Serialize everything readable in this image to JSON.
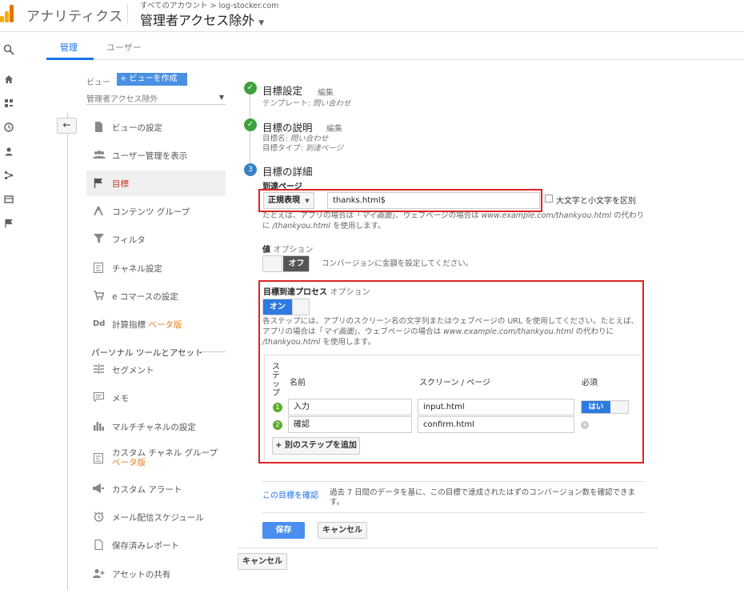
{
  "app": {
    "title": "アナリティクス",
    "breadcrumb": "すべてのアカウント > log-stocker.com",
    "view_name": "管理者アクセス除外"
  },
  "rail_icons": [
    "search-icon",
    "home-icon",
    "dashboard-icon",
    "clock-icon",
    "person-icon",
    "acquisition-icon",
    "behavior-icon",
    "flag-icon"
  ],
  "tabs": [
    {
      "label": "管理",
      "active": true
    },
    {
      "label": "ユーザー",
      "active": false
    }
  ],
  "view_panel": {
    "label": "ビュー",
    "create_button": "+ ビューを作成",
    "selected_view": "管理者アクセス除外",
    "back_icon": "←",
    "items": [
      {
        "label": "ビューの設定"
      },
      {
        "label": "ユーザー管理を表示"
      },
      {
        "label": "目標"
      },
      {
        "label": "コンテンツ グループ"
      },
      {
        "label": "フィルタ"
      },
      {
        "label": "チャネル設定"
      },
      {
        "label": "e コマースの設定"
      },
      {
        "label": "計算指標",
        "badge": "ベータ版"
      }
    ],
    "personal_header": "パーソナル ツールとアセット",
    "personal_items": [
      {
        "label": "セグメント"
      },
      {
        "label": "メモ"
      },
      {
        "label": "マルチチャネルの設定"
      },
      {
        "label": "カスタム チャネル グループ",
        "badge": "ベータ版"
      },
      {
        "label": "カスタム アラート"
      },
      {
        "label": "メール配信スケジュール"
      },
      {
        "label": "保存済みレポート"
      },
      {
        "label": "アセットの共有"
      }
    ]
  },
  "goal": {
    "setup": {
      "title": "目標設定",
      "edit": "編集",
      "template_label": "テンプレート:",
      "template_value": "問い合わせ"
    },
    "description": {
      "title": "目標の説明",
      "edit": "編集",
      "name_label": "目標名:",
      "name_value": "問い合わせ",
      "type_label": "目標タイプ:",
      "type_value": "到達ページ"
    },
    "details": {
      "step_number": "3",
      "title": "目標の詳細",
      "destination_label": "到達ページ",
      "match_type": "正規表現",
      "destination_value": "thanks.html$",
      "case_sensitive_label": "大文字と小文字を区別",
      "destination_help_1": "たとえば、アプリの場合は「",
      "destination_help_2": "マイ画面",
      "destination_help_3": "」、ウェブページの場合は ",
      "destination_help_4": "www.example.com/thankyou.html",
      "destination_help_5": " の代わりに ",
      "destination_help_6": "/thankyou.html",
      "destination_help_7": " を使用します。",
      "value_label": "値",
      "value_optional": "オプション",
      "value_toggle": "オフ",
      "value_help": "コンバージョンに金額を設定してください。",
      "funnel_label": "目標到達プロセス",
      "funnel_optional": "オプション",
      "funnel_toggle": "オン",
      "funnel_help_1": "各ステップには、アプリのスクリーン名の文字列またはウェブページの URL を使用してください。たとえば、アプリの場合は「",
      "funnel_help_2": "マイ画面",
      "funnel_help_3": "」、ウェブページの場合は ",
      "funnel_help_4": "www.example.com/thankyou.html",
      "funnel_help_5": " の代わりに ",
      "funnel_help_6": "/thankyou.html",
      "funnel_help_7": " を使用します。",
      "columns": {
        "step": "ステップ",
        "name": "名前",
        "screen": "スクリーン / ページ",
        "required": "必須"
      },
      "steps": [
        {
          "num": "1",
          "name": "入力",
          "screen": "input.html",
          "required": "はい"
        },
        {
          "num": "2",
          "name": "確認",
          "screen": "confirm.html"
        }
      ],
      "add_step": "+ 別のステップを追加"
    },
    "verify_link": "この目標を確認",
    "verify_text": "過去 7 日間のデータを基に、この目標で達成されたはずのコンバージョン数を確認できます。",
    "save": "保存",
    "cancel": "キャンセル",
    "outer_cancel": "キャンセル"
  },
  "colors": {
    "accent": "#1a73e8",
    "highlight_red": "#e02424",
    "check_green": "#3ea13e",
    "beta_orange": "#e67e22"
  }
}
